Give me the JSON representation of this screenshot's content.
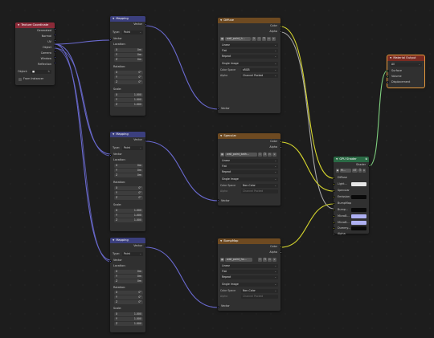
{
  "texcoord": {
    "title": "Texture Coordinate",
    "outputs": [
      "Generated",
      "Normal",
      "UV",
      "Object",
      "Camera",
      "Window",
      "Reflection"
    ],
    "object_label": "Object:",
    "from_instancer": "From Instancer"
  },
  "mappings": [
    {
      "title": "Mapping",
      "out": "Vector",
      "type_label": "Type:",
      "type_value": "Point",
      "in_vector": "Vector",
      "location_label": "Location:",
      "location": [
        {
          "a": "X",
          "v": "0m"
        },
        {
          "a": "Y",
          "v": "0m"
        },
        {
          "a": "Z",
          "v": "0m"
        }
      ],
      "rotation_label": "Rotation:",
      "rotation": [
        {
          "a": "X",
          "v": "0°"
        },
        {
          "a": "Y",
          "v": "0°"
        },
        {
          "a": "Z",
          "v": "0°"
        }
      ],
      "scale_label": "Scale:",
      "scale": [
        {
          "a": "X",
          "v": "1.000"
        },
        {
          "a": "Y",
          "v": "1.000"
        },
        {
          "a": "Z",
          "v": "1.000"
        }
      ]
    },
    {
      "title": "Mapping",
      "out": "Vector",
      "type_label": "Type:",
      "type_value": "Point",
      "in_vector": "Vector",
      "location_label": "Location:",
      "location": [
        {
          "a": "X",
          "v": "0m"
        },
        {
          "a": "Y",
          "v": "0m"
        },
        {
          "a": "Z",
          "v": "0m"
        }
      ],
      "rotation_label": "Rotation:",
      "rotation": [
        {
          "a": "X",
          "v": "0°"
        },
        {
          "a": "Y",
          "v": "0°"
        },
        {
          "a": "Z",
          "v": "0°"
        }
      ],
      "scale_label": "Scale:",
      "scale": [
        {
          "a": "X",
          "v": "1.000"
        },
        {
          "a": "Y",
          "v": "1.000"
        },
        {
          "a": "Z",
          "v": "1.000"
        }
      ]
    },
    {
      "title": "Mapping",
      "out": "Vector",
      "type_label": "Type:",
      "type_value": "Point",
      "in_vector": "Vector",
      "location_label": "Location:",
      "location": [
        {
          "a": "X",
          "v": "0m"
        },
        {
          "a": "Y",
          "v": "0m"
        },
        {
          "a": "Z",
          "v": "0m"
        }
      ],
      "rotation_label": "Rotation:",
      "rotation": [
        {
          "a": "X",
          "v": "0°"
        },
        {
          "a": "Y",
          "v": "0°"
        },
        {
          "a": "Z",
          "v": "0°"
        }
      ],
      "scale_label": "Scale:",
      "scale": [
        {
          "a": "X",
          "v": "1.000"
        },
        {
          "a": "Y",
          "v": "1.000"
        },
        {
          "a": "Z",
          "v": "1.000"
        }
      ]
    }
  ],
  "textures": [
    {
      "title": "Diffuse",
      "out_color": "Color",
      "out_alpha": "Alpha",
      "image_name": "wall_paint_h...",
      "users": "2",
      "interp": "Linear",
      "proj": "Flat",
      "ext": "Repeat",
      "source": "Single Image",
      "cs_label": "Color Space",
      "cs_value": "sRGB",
      "alpha_label": "Alpha",
      "alpha_value": "Channel Packed",
      "in_vector": "Vector"
    },
    {
      "title": "Specular",
      "out_color": "Color",
      "out_alpha": "Alpha",
      "image_name": "wall_paint_bath...",
      "users": "",
      "interp": "Linear",
      "proj": "Flat",
      "ext": "Repeat",
      "source": "Single Image",
      "cs_label": "Color Space",
      "cs_value": "Non-Color",
      "alpha_label": "Alpha",
      "alpha_value": "Channel Packed",
      "in_vector": "Vector"
    },
    {
      "title": "BumpMap",
      "out_color": "Color",
      "out_alpha": "Alpha",
      "image_name": "wall_paint_ho...",
      "users": "",
      "interp": "Linear",
      "proj": "Flat",
      "ext": "Repeat",
      "source": "Single Image",
      "cs_label": "Color Space",
      "cs_value": "Non-Color",
      "alpha_label": "Alpha",
      "alpha_value": "Channel Packed",
      "in_vector": "Vector"
    }
  ],
  "gpu": {
    "title": "GPU Shader",
    "out": "Shader",
    "material": "M...",
    "users": "47",
    "inputs": [
      {
        "label": "Diffuse",
        "swatch": ""
      },
      {
        "label": "Light...",
        "swatch": "#e6e6e6"
      },
      {
        "label": "Specular",
        "swatch": ""
      },
      {
        "label": "Emission",
        "swatch": "#0a0a0a"
      },
      {
        "label": "BumpMap",
        "swatch": ""
      },
      {
        "label": "Bump...",
        "swatch": "#0a0a0a"
      },
      {
        "label": "MicroB...",
        "swatch": "#aeb0f2"
      },
      {
        "label": "MicroB...",
        "swatch": "#aeb0f2"
      },
      {
        "label": "Dummy...",
        "swatch": "#0a0a0a"
      },
      {
        "label": "Alpha",
        "swatch": ""
      }
    ]
  },
  "output": {
    "title": "Material Output",
    "target": "All",
    "inputs": [
      "Surface",
      "Volume",
      "Displacement"
    ]
  },
  "colors": {
    "vector_wire": "#6a6ad0",
    "color_wire": "#d6d62e",
    "shader_wire": "#7fd07f",
    "selection": "#e89a3c"
  }
}
